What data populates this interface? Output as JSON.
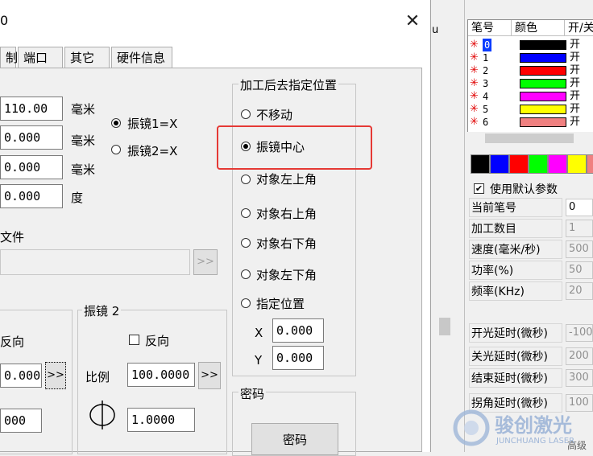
{
  "dialog": {
    "title": "0",
    "close_symbol": "✕",
    "tabs": [
      "制",
      "端口",
      "其它",
      "硬件信息"
    ]
  },
  "fields": {
    "row1_value": "110.00",
    "row2_value": "0.000",
    "row3_value": "0.000",
    "row4_value": "0.000",
    "unit_mm": "毫米",
    "unit_deg": "度",
    "galvo1_x": "振镜1=X",
    "galvo2_x": "振镜2=X",
    "file_label": "文件",
    "browse": ">>"
  },
  "after_process": {
    "title": "加工后去指定位置",
    "options": [
      "不移动",
      "振镜中心",
      "对象左上角",
      "对象右上角",
      "对象右下角",
      "对象左下角",
      "指定位置"
    ],
    "selected": "振镜中心",
    "x_label": "X",
    "y_label": "Y",
    "x_value": "0.000",
    "y_value": "0.000"
  },
  "galvo1": {
    "reverse": "反向",
    "value": "0.0000",
    "btn": ">>",
    "value2": "000"
  },
  "galvo2": {
    "title": "振镜 2",
    "reverse": "反向",
    "ratio_label": "比例",
    "ratio_value": "100.0000",
    "btn": ">>",
    "value2": "1.0000"
  },
  "password": {
    "title": "密码",
    "button": "密码"
  },
  "pen_table": {
    "headers": [
      "笔号",
      "颜色",
      "开/关"
    ],
    "rows": [
      {
        "num": "0",
        "color": "#000000",
        "state": "开"
      },
      {
        "num": "1",
        "color": "#0000ff",
        "state": "开"
      },
      {
        "num": "2",
        "color": "#ff0000",
        "state": "开"
      },
      {
        "num": "3",
        "color": "#00ff00",
        "state": "开"
      },
      {
        "num": "4",
        "color": "#ff00ff",
        "state": "开"
      },
      {
        "num": "5",
        "color": "#ffff00",
        "state": "开"
      },
      {
        "num": "6",
        "color": "#f08080",
        "state": "开"
      }
    ],
    "star": "✳"
  },
  "palette": [
    "#000000",
    "#0000ff",
    "#ff0000",
    "#00ff00",
    "#ff00ff",
    "#ffff00",
    "#f08080"
  ],
  "params": {
    "use_default": "使用默认参数",
    "labels": [
      "当前笔号",
      "加工数目",
      "速度(毫米/秒)",
      "功率(%)",
      "频率(KHz)",
      "开光延时(微秒)",
      "关光延时(微秒)",
      "结束延时(微秒)",
      "拐角延时(微秒)"
    ],
    "values": [
      "0",
      "1",
      "500",
      "50",
      "20",
      "-100",
      "200",
      "300",
      "100"
    ]
  },
  "watermark": {
    "brand": "骏创激光",
    "sub": "JUNCHUANG LASER"
  },
  "misc": {
    "partial_top": "u",
    "partial_bottom": "高级"
  }
}
